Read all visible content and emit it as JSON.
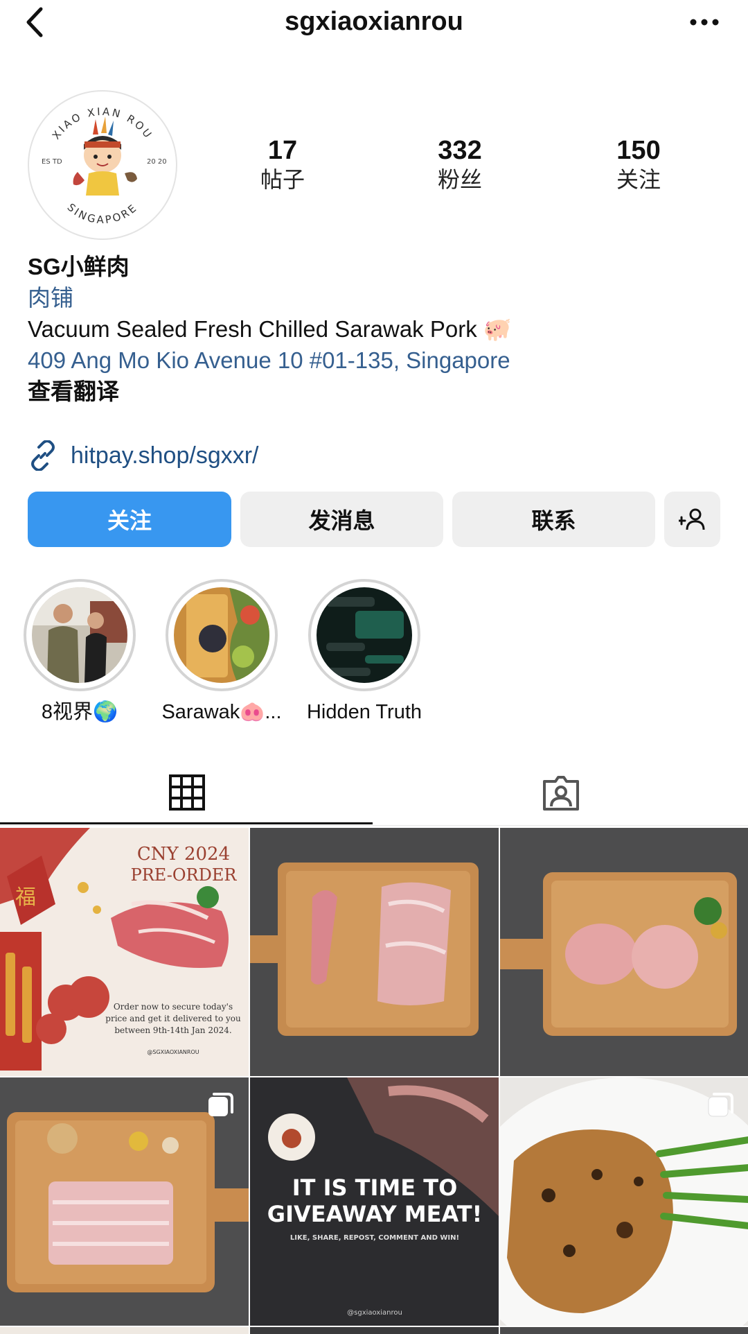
{
  "header": {
    "username": "sgxiaoxianrou",
    "back_icon": "chevron-left-icon",
    "more_icon": "more-horizontal-icon"
  },
  "avatar": {
    "arc_top": "XIAO XIAN ROU",
    "arc_bottom": "SINGAPORE",
    "est_left": "ES TD",
    "est_right": "20 20"
  },
  "stats": [
    {
      "value": "17",
      "label": "帖子"
    },
    {
      "value": "332",
      "label": "粉丝"
    },
    {
      "value": "150",
      "label": "关注"
    }
  ],
  "bio": {
    "name": "SG小鲜肉",
    "category": "肉铺",
    "description": "Vacuum Sealed Fresh Chilled Sarawak Pork 🐖",
    "address": "409 Ang Mo Kio Avenue 10 #01-135, Singapore",
    "translate": "查看翻译",
    "link_icon": "link-icon",
    "link": "hitpay.shop/sgxxr/"
  },
  "actions": {
    "follow": "关注",
    "message": "发消息",
    "contact": "联系",
    "suggest_icon": "add-person-icon"
  },
  "highlights": [
    {
      "label": "8视界🌍"
    },
    {
      "label": "Sarawak🐽..."
    },
    {
      "label": "Hidden Truth"
    }
  ],
  "tabs": {
    "grid_icon": "grid-icon",
    "tagged_icon": "tagged-person-icon"
  },
  "posts": {
    "cny": {
      "title1": "CNY 2024",
      "title2": "PRE-ORDER",
      "body1": "Order now to secure today's",
      "body2": "price and get it delivered to you",
      "body3": "between 9th-14th Jan 2024.",
      "handle": "@SGXIAOXIANROU"
    },
    "giveaway": {
      "line1": "IT IS TIME TO",
      "line2": "GIVEAWAY MEAT!",
      "line3": "LIKE, SHARE, REPOST, COMMENT AND WIN!",
      "handle": "@sgxiaoxianrou"
    },
    "multi_icon": "carousel-icon"
  },
  "colors": {
    "follow_button": "#3897f0",
    "link_blue": "#355f8f",
    "button_gray": "#efefef"
  }
}
